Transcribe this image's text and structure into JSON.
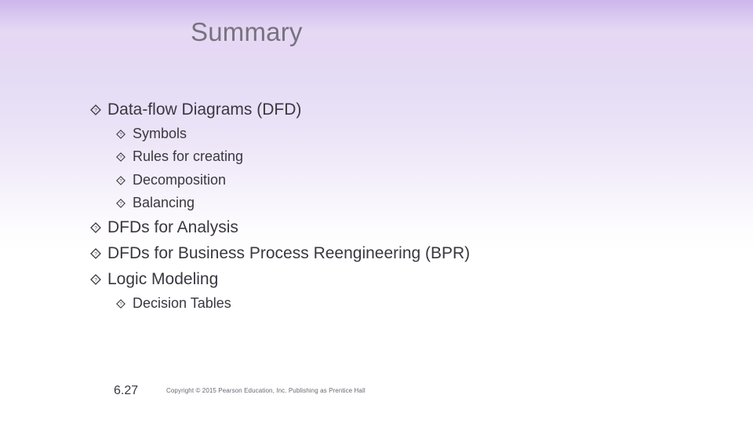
{
  "slide": {
    "title": "Summary",
    "bullets": [
      {
        "level": 1,
        "text": "Data-flow Diagrams (DFD)"
      },
      {
        "level": 2,
        "text": "Symbols"
      },
      {
        "level": 2,
        "text": "Rules for creating"
      },
      {
        "level": 2,
        "text": "Decomposition"
      },
      {
        "level": 2,
        "text": "Balancing"
      },
      {
        "level": 1,
        "text": "DFDs for Analysis"
      },
      {
        "level": 1,
        "text": "DFDs for Business Process Reengineering (BPR)"
      },
      {
        "level": 1,
        "text": "Logic Modeling"
      },
      {
        "level": 2,
        "text": "Decision Tables"
      }
    ],
    "bullet_icon": "diamond-question-icon",
    "footer": {
      "page_number": "6.27",
      "copyright": "Copyright © 2015 Pearson Education, Inc. Publishing as Prentice Hall"
    }
  }
}
